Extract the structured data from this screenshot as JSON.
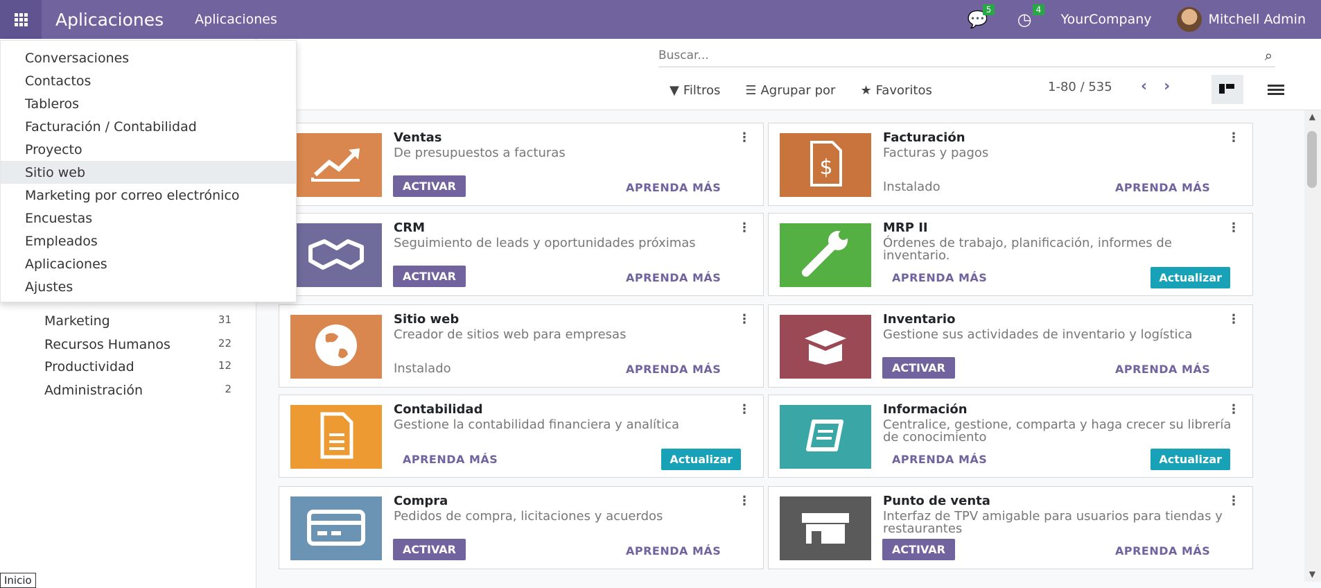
{
  "navbar": {
    "brand": "Aplicaciones",
    "menu": "Aplicaciones",
    "messages_count": "5",
    "activities_count": "4",
    "company": "YourCompany",
    "user": "Mitchell Admin"
  },
  "search": {
    "placeholder": "Buscar..."
  },
  "filters": {
    "filters": "Filtros",
    "group_by": "Agrupar por",
    "favorites": "Favoritos"
  },
  "pager": {
    "text": "1-80 / 535"
  },
  "menu_items": [
    "Conversaciones",
    "Contactos",
    "Tableros",
    "Facturación / Contabilidad",
    "Proyecto",
    "Sitio web",
    "Marketing por correo electrónico",
    "Encuestas",
    "Empleados",
    "Aplicaciones",
    "Ajustes"
  ],
  "categories": [
    {
      "name": "Marketing",
      "count": "31"
    },
    {
      "name": "Recursos Humanos",
      "count": "22"
    },
    {
      "name": "Productividad",
      "count": "12"
    },
    {
      "name": "Administración",
      "count": "2"
    }
  ],
  "apps": [
    {
      "title": "Ventas",
      "summary": "De presupuestos a facturas",
      "state": "activar",
      "color": "#d9874f",
      "icon": "chart-up-icon"
    },
    {
      "title": "Facturación",
      "summary": "Facturas y pagos",
      "state": "installed",
      "color": "#c9743c",
      "icon": "invoice-dollar-icon"
    },
    {
      "title": "CRM",
      "summary": "Seguimiento de leads y oportunidades próximas",
      "state": "activar",
      "color": "#6f6b9b",
      "icon": "handshake-icon"
    },
    {
      "title": "MRP II",
      "summary": "Órdenes de trabajo, planificación, informes de inventario.",
      "state": "update",
      "color": "#55b043",
      "icon": "wrench-icon"
    },
    {
      "title": "Sitio web",
      "summary": "Creador de sitios web para empresas",
      "state": "installed",
      "color": "#d9874f",
      "icon": "globe-icon"
    },
    {
      "title": "Inventario",
      "summary": "Gestione sus actividades de inventario y logística",
      "state": "activar",
      "color": "#9b4a55",
      "icon": "box-icon"
    },
    {
      "title": "Contabilidad",
      "summary": "Gestione la contabilidad financiera y analítica",
      "state": "update",
      "color": "#ee9a33",
      "icon": "document-icon"
    },
    {
      "title": "Información",
      "summary": "Centralice, gestione, comparta y haga crecer su librería de conocimiento",
      "state": "update",
      "color": "#3aa6a6",
      "icon": "book-icon"
    },
    {
      "title": "Compra",
      "summary": "Pedidos de compra, licitaciones y acuerdos",
      "state": "activar",
      "color": "#6b93b3",
      "icon": "credit-card-icon"
    },
    {
      "title": "Punto de venta",
      "summary": "Interfaz de TPV amigable para usuarios para tiendas y restaurantes",
      "state": "activar",
      "color": "#5a5a5a",
      "icon": "store-icon"
    }
  ],
  "labels": {
    "activar": "ACTIVAR",
    "learn_more": "APRENDA MÁS",
    "update": "Actualizar",
    "installed": "Instalado"
  },
  "tooltip": "Inicio"
}
